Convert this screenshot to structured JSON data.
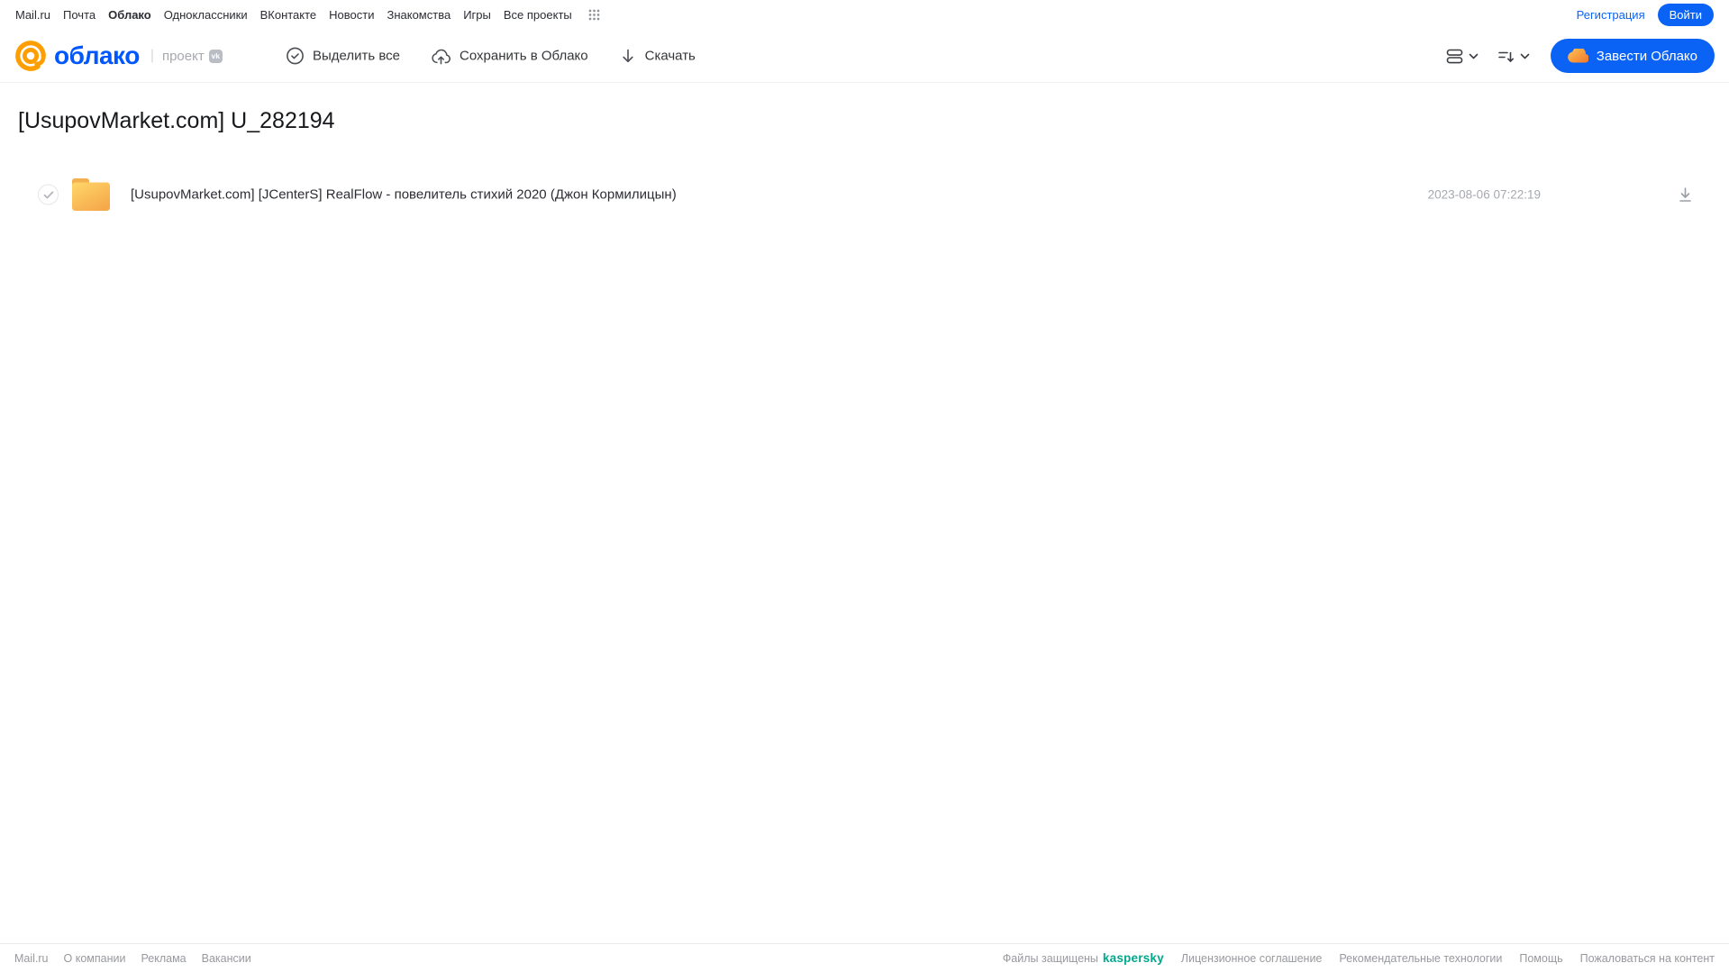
{
  "top_nav": {
    "links": [
      {
        "label": "Mail.ru",
        "active": false
      },
      {
        "label": "Почта",
        "active": false
      },
      {
        "label": "Облако",
        "active": true
      },
      {
        "label": "Одноклассники",
        "active": false
      },
      {
        "label": "ВКонтакте",
        "active": false
      },
      {
        "label": "Новости",
        "active": false
      },
      {
        "label": "Знакомства",
        "active": false
      },
      {
        "label": "Игры",
        "active": false
      },
      {
        "label": "Все проекты",
        "active": false
      }
    ],
    "auth": {
      "register": "Регистрация",
      "login": "Войти"
    }
  },
  "header": {
    "logo": {
      "brand": "облако",
      "divider": "|",
      "project": "проект",
      "vk_badge": "vk"
    },
    "actions": {
      "select_all": "Выделить все",
      "save_to_cloud": "Сохранить в Облако",
      "download": "Скачать"
    },
    "cta": "Завести Облако"
  },
  "main": {
    "title": "[UsupovMarket.com] U_282194",
    "files": [
      {
        "type": "folder",
        "name": "[UsupovMarket.com] [JCenterS] RealFlow - повелитель стихий 2020 (Джон Кормилицын)",
        "date": "2023-08-06 07:22:19"
      }
    ]
  },
  "footer": {
    "left_links": [
      "Mail.ru",
      "О компании",
      "Реклама",
      "Вакансии"
    ],
    "protected_label": "Файлы защищены",
    "kaspersky_logo": "kaspersky",
    "right_links": [
      "Лицензионное соглашение",
      "Рекомендательные технологии",
      "Помощь",
      "Пожаловаться на контент"
    ]
  },
  "colors": {
    "accent_blue": "#0b63f6",
    "logo_orange": "#ff9e00",
    "folder_top": "#ffd769",
    "folder_bottom": "#f6a94b",
    "kaspersky_teal": "#00a88e"
  }
}
